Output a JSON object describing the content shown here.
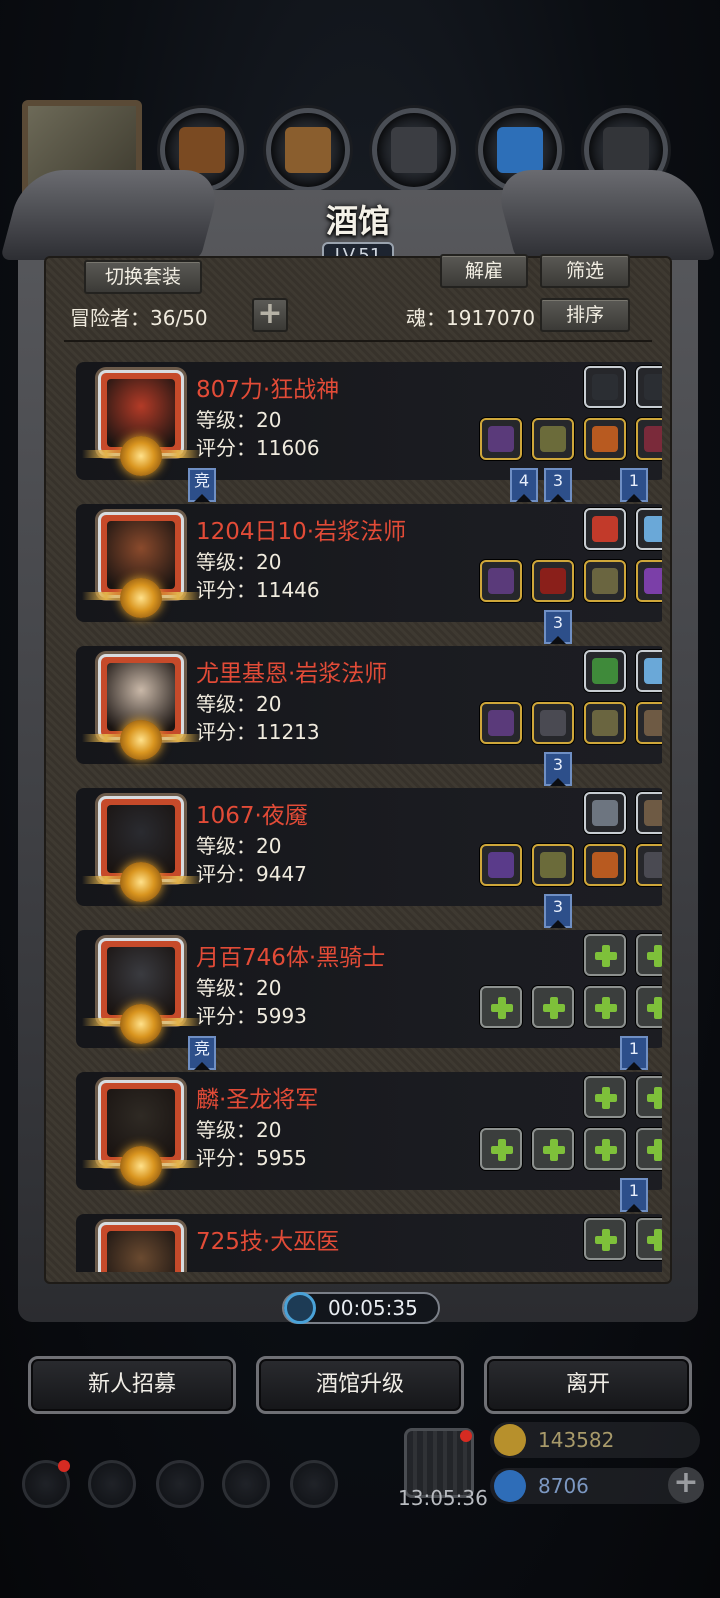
{
  "window": {
    "title": "酒馆",
    "level": "LV.51"
  },
  "toolbar": {
    "switch_outfit": "切换套装",
    "dismiss": "解雇",
    "filter": "筛选",
    "sort": "排序",
    "adventurers_label": "冒险者：36/50",
    "soul_label": "魂：1917070"
  },
  "heroes": [
    {
      "name": "807力·狂战神",
      "level": "等级：20",
      "score": "评分：11606",
      "top_slots": [
        "feather-icon",
        "feather-icon"
      ],
      "bottom_slots": [
        "staff-icon",
        "armor-icon",
        "ring-icon",
        "helm-icon"
      ],
      "badges": [
        {
          "label": "竞"
        },
        {
          "label": "4"
        },
        {
          "label": "3"
        },
        {
          "label": "1"
        }
      ]
    },
    {
      "name": "1204日10·岩浆法师",
      "level": "等级：20",
      "score": "评分：11446",
      "top_slots": [
        "gem-icon",
        "crystal-icon"
      ],
      "bottom_slots": [
        "staff-icon",
        "robe-icon",
        "gauntlet-icon",
        "orb-icon"
      ],
      "badges": [
        {
          "label": "3"
        }
      ]
    },
    {
      "name": "尤里基恩·岩浆法师",
      "level": "等级：20",
      "score": "评分：11213",
      "top_slots": [
        "book-icon",
        "crystal-icon"
      ],
      "bottom_slots": [
        "staff-icon",
        "cloak-icon",
        "gauntlet-icon",
        "mask-icon"
      ],
      "badges": [
        {
          "label": "3"
        }
      ]
    },
    {
      "name": "1067·夜魇",
      "level": "等级：20",
      "score": "评分：9447",
      "top_slots": [
        "card-icon",
        "mask-icon"
      ],
      "bottom_slots": [
        "sword-icon",
        "armor-icon",
        "ring-icon",
        "cloak-icon"
      ],
      "badges": [
        {
          "label": "3"
        }
      ]
    },
    {
      "name": "月百746体·黑骑士",
      "level": "等级：20",
      "score": "评分：5993",
      "top_slots": [
        "empty",
        "empty"
      ],
      "bottom_slots": [
        "empty",
        "empty",
        "empty",
        "empty"
      ],
      "badges": [
        {
          "label": "竞"
        },
        {
          "label": "1"
        }
      ]
    },
    {
      "name": "麟·圣龙将军",
      "level": "等级：20",
      "score": "评分：5955",
      "top_slots": [
        "empty",
        "empty"
      ],
      "bottom_slots": [
        "empty",
        "empty",
        "empty",
        "empty"
      ],
      "badges": [
        {
          "label": "1"
        }
      ]
    },
    {
      "name": "725技·大巫医",
      "top_slots": [
        "empty",
        "empty"
      ]
    }
  ],
  "timer": "00:05:35",
  "actions": {
    "recruit": "新人招募",
    "upgrade": "酒馆升级",
    "leave": "离开"
  },
  "resources": {
    "gold": "143582",
    "gems": "8706"
  },
  "clock": "13:05:36",
  "colors": {
    "name_red": "#e24b37",
    "badge_blue": "#2d4f8a",
    "frame_gray": "#58595d"
  }
}
